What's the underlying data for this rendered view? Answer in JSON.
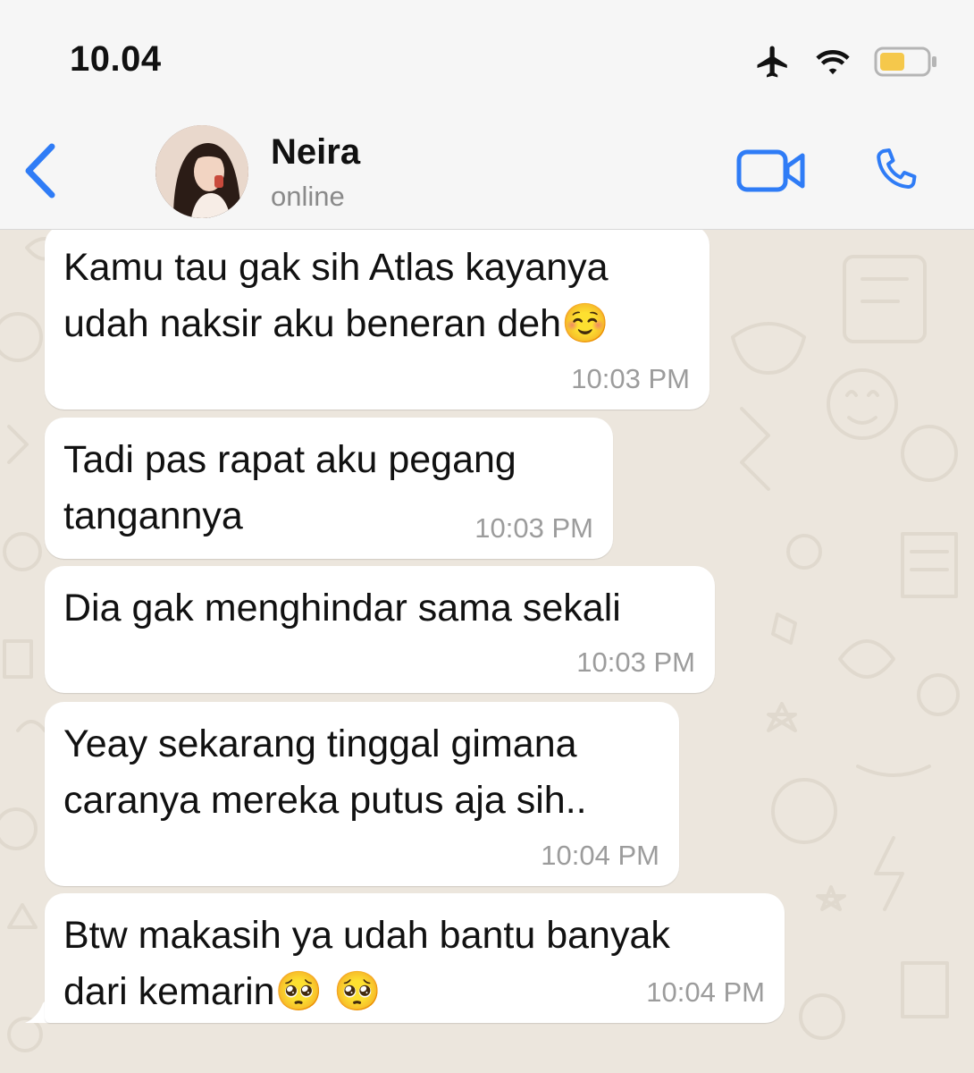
{
  "status_bar": {
    "time": "10.04",
    "icons": [
      "airplane-icon",
      "wifi-icon",
      "battery-icon"
    ],
    "battery_color": "#f5c84b"
  },
  "header": {
    "back_icon": "chevron-left-icon",
    "contact_name": "Neira",
    "contact_status": "online",
    "actions": [
      "video-call-icon",
      "phone-call-icon"
    ],
    "accent_color": "#2f7cf6"
  },
  "messages": [
    {
      "text": "Kamu tau gak sih Atlas kayanya\nudah naksir aku beneran deh☺️",
      "time": "10:03 PM"
    },
    {
      "text": "Tadi pas rapat aku pegang\ntangannya",
      "time": "10:03 PM"
    },
    {
      "text": "Dia gak menghindar sama sekali",
      "time": "10:03 PM"
    },
    {
      "text": "Yeay sekarang tinggal gimana\ncaranya mereka putus aja sih..",
      "time": "10:04 PM"
    },
    {
      "text": "Btw makasih ya udah bantu banyak\ndari kemarin🥺 🥺",
      "time": "10:04 PM"
    }
  ]
}
